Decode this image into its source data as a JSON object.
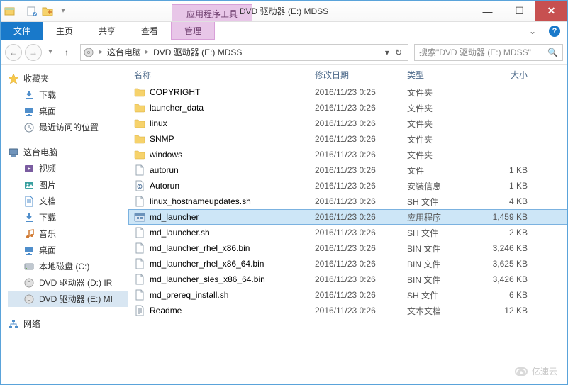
{
  "title_bar": {
    "ribbon_context_label": "应用程序工具",
    "window_title": "DVD 驱动器 (E:) MDSS"
  },
  "ribbon": {
    "file_tab": "文件",
    "tabs": [
      "主页",
      "共享",
      "查看"
    ],
    "context_tab": "管理"
  },
  "breadcrumb": {
    "segments": [
      "这台电脑",
      "DVD 驱动器 (E:) MDSS"
    ]
  },
  "search": {
    "placeholder": "搜索\"DVD 驱动器 (E:) MDSS\""
  },
  "sidebar": {
    "favorites": {
      "label": "收藏夹",
      "items": [
        "下载",
        "桌面",
        "最近访问的位置"
      ]
    },
    "computer": {
      "label": "这台电脑",
      "items": [
        "视频",
        "图片",
        "文档",
        "下载",
        "音乐",
        "桌面",
        "本地磁盘 (C:)",
        "DVD 驱动器 (D:) IR",
        "DVD 驱动器 (E:) MI"
      ]
    },
    "network": {
      "label": "网络"
    }
  },
  "columns": {
    "name": "名称",
    "date": "修改日期",
    "type": "类型",
    "size": "大小"
  },
  "files": [
    {
      "icon": "folder",
      "name": "COPYRIGHT",
      "date": "2016/11/23 0:25",
      "type": "文件夹",
      "size": ""
    },
    {
      "icon": "folder",
      "name": "launcher_data",
      "date": "2016/11/23 0:26",
      "type": "文件夹",
      "size": ""
    },
    {
      "icon": "folder",
      "name": "linux",
      "date": "2016/11/23 0:26",
      "type": "文件夹",
      "size": ""
    },
    {
      "icon": "folder",
      "name": "SNMP",
      "date": "2016/11/23 0:26",
      "type": "文件夹",
      "size": ""
    },
    {
      "icon": "folder",
      "name": "windows",
      "date": "2016/11/23 0:26",
      "type": "文件夹",
      "size": ""
    },
    {
      "icon": "file",
      "name": "autorun",
      "date": "2016/11/23 0:26",
      "type": "文件",
      "size": "1 KB"
    },
    {
      "icon": "inf",
      "name": "Autorun",
      "date": "2016/11/23 0:26",
      "type": "安装信息",
      "size": "1 KB"
    },
    {
      "icon": "file",
      "name": "linux_hostnameupdates.sh",
      "date": "2016/11/23 0:26",
      "type": "SH 文件",
      "size": "4 KB"
    },
    {
      "icon": "exe",
      "name": "md_launcher",
      "date": "2016/11/23 0:26",
      "type": "应用程序",
      "size": "1,459 KB",
      "selected": true
    },
    {
      "icon": "file",
      "name": "md_launcher.sh",
      "date": "2016/11/23 0:26",
      "type": "SH 文件",
      "size": "2 KB"
    },
    {
      "icon": "file",
      "name": "md_launcher_rhel_x86.bin",
      "date": "2016/11/23 0:26",
      "type": "BIN 文件",
      "size": "3,246 KB"
    },
    {
      "icon": "file",
      "name": "md_launcher_rhel_x86_64.bin",
      "date": "2016/11/23 0:26",
      "type": "BIN 文件",
      "size": "3,625 KB"
    },
    {
      "icon": "file",
      "name": "md_launcher_sles_x86_64.bin",
      "date": "2016/11/23 0:26",
      "type": "BIN 文件",
      "size": "3,426 KB"
    },
    {
      "icon": "file",
      "name": "md_prereq_install.sh",
      "date": "2016/11/23 0:26",
      "type": "SH 文件",
      "size": "6 KB"
    },
    {
      "icon": "text",
      "name": "Readme",
      "date": "2016/11/23 0:26",
      "type": "文本文档",
      "size": "12 KB"
    }
  ],
  "watermark": "亿速云"
}
